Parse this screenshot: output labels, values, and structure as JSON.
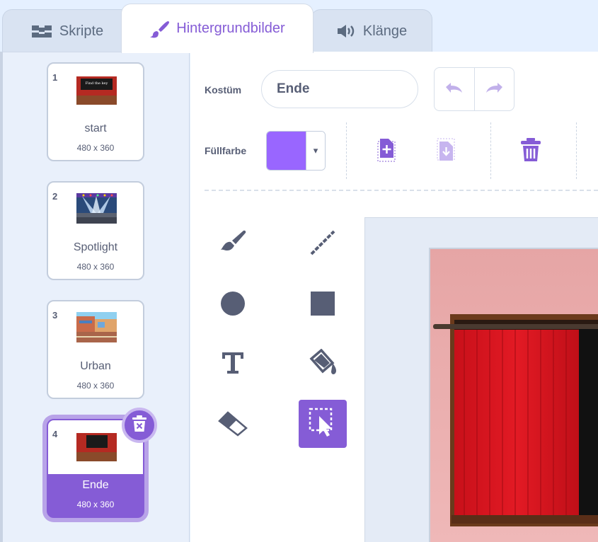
{
  "tabs": [
    {
      "label": "Skripte",
      "icon": "code-icon"
    },
    {
      "label": "Hintergrundbilder",
      "icon": "paintbrush-icon"
    },
    {
      "label": "Klänge",
      "icon": "speaker-icon"
    }
  ],
  "backdrops": [
    {
      "number": "1",
      "name": "start",
      "size": "480 x 360"
    },
    {
      "number": "2",
      "name": "Spotlight",
      "size": "480 x 360"
    },
    {
      "number": "3",
      "name": "Urban",
      "size": "480 x 360"
    },
    {
      "number": "4",
      "name": "Ende",
      "size": "480 x 360",
      "selected": true
    }
  ],
  "thumbnail_text": {
    "start": "Find the key"
  },
  "editor": {
    "costume_label": "Kostüm",
    "costume_name": "Ende",
    "fill_label": "Füllfarbe",
    "fill_color": "#9966ff",
    "fill_dropdown_arrow": "▾"
  },
  "tools": [
    "brush-icon",
    "line-icon",
    "circle-icon",
    "rectangle-icon",
    "text-icon",
    "fill-icon",
    "eraser-icon",
    "select-icon"
  ],
  "colors": {
    "accent": "#855cd6",
    "sidebar": "#e9f0fb",
    "text": "#575e75"
  }
}
